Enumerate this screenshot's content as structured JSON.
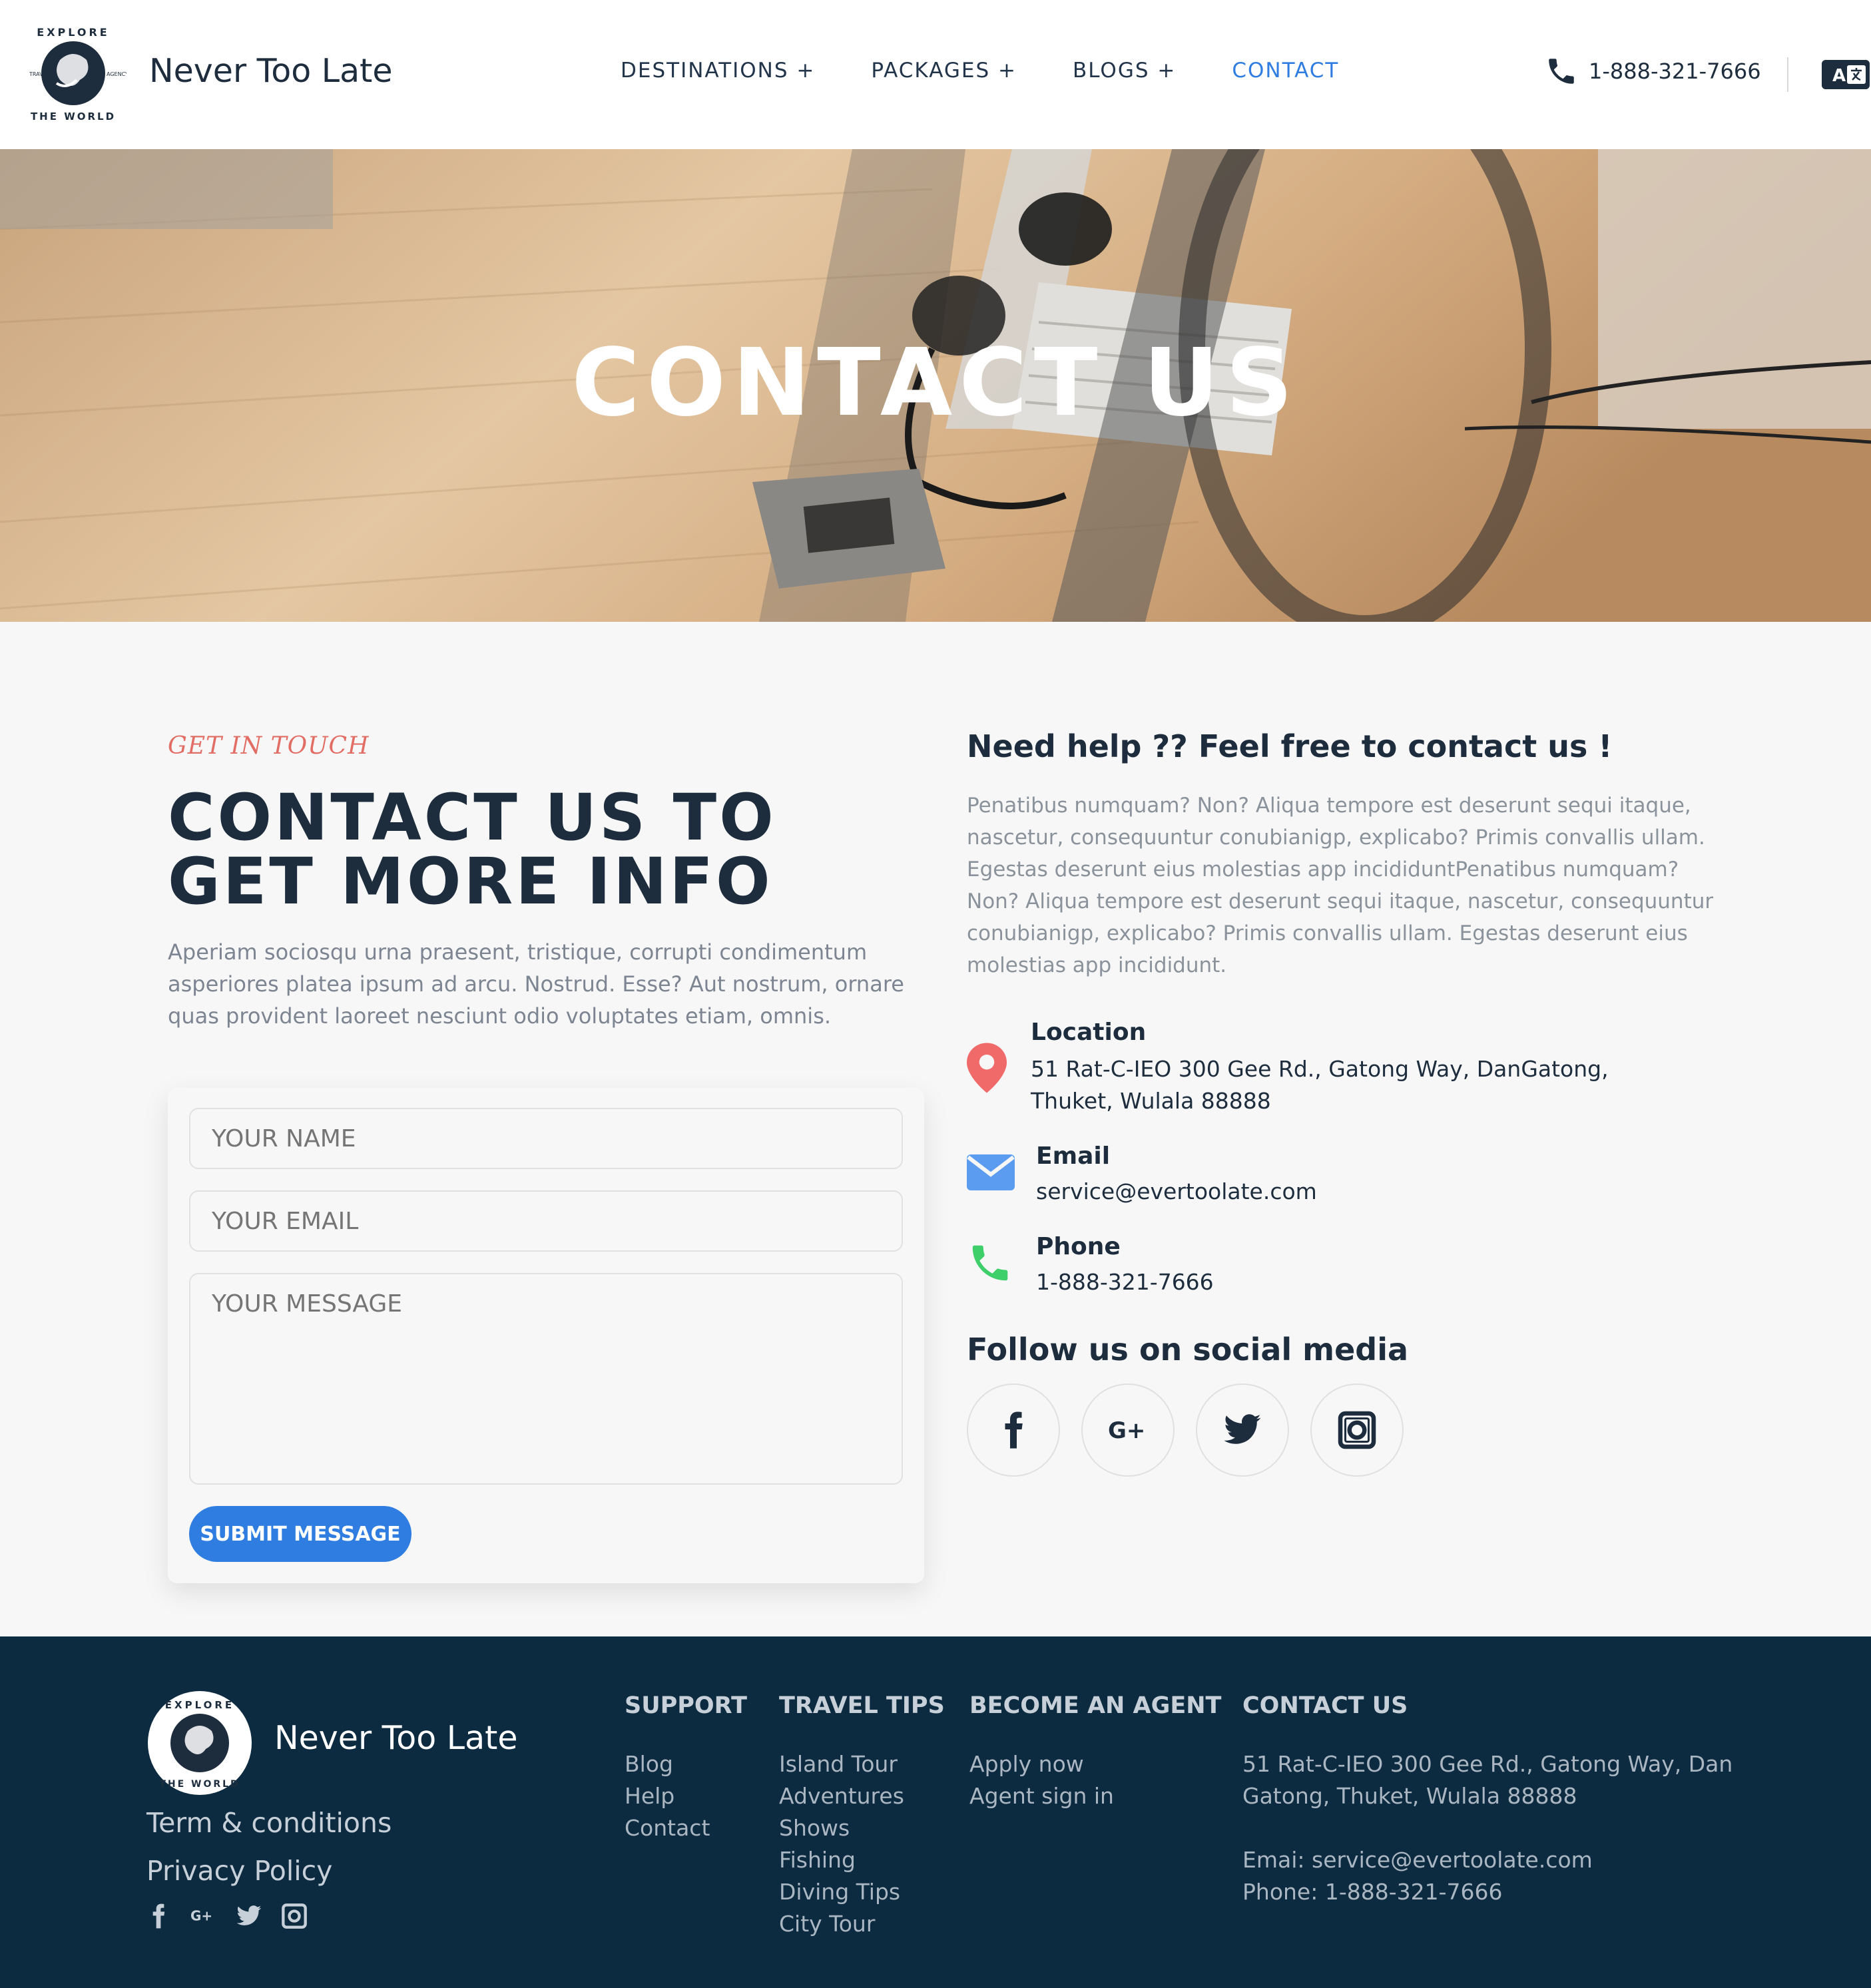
{
  "header": {
    "brand": "Never Too Late",
    "nav": [
      "DESTINATIONS +",
      "PACKAGES +",
      "BLOGS +",
      "CONTACT"
    ],
    "active_nav": "CONTACT",
    "phone": "1-888-321-7666",
    "logo_text": {
      "top": "EXPLORE",
      "bottom": "THE WORLD",
      "left": "TRAVEL",
      "right": "AGENCY"
    }
  },
  "hero": {
    "title": "CONTACT US"
  },
  "contact": {
    "kicker": "GET IN TOUCH",
    "heading": "CONTACT US TO GET MORE INFO",
    "intro": "Aperiam sociosqu urna praesent, tristique, corrupti condimentum asperiores platea ipsum ad arcu. Nostrud. Esse? Aut nostrum, ornare quas provident laoreet nesciunt odio voluptates etiam, omnis."
  },
  "form": {
    "name_placeholder": "YOUR NAME",
    "email_placeholder": "YOUR EMAIL",
    "message_placeholder": "YOUR MESSAGE",
    "submit_label": "SUBMIT MESSAGE"
  },
  "help": {
    "title": "Need help ?? Feel free to contact us !",
    "text": "Penatibus numquam? Non? Aliqua tempore est deserunt sequi itaque, nascetur, consequuntur conubianigp, explicabo? Primis convallis ullam. Egestas deserunt eius molestias app incididuntPenatibus numquam? Non? Aliqua tempore est deserunt sequi itaque, nascetur, consequuntur conubianigp, explicabo? Primis convallis ullam. Egestas deserunt eius molestias app incididunt."
  },
  "info": {
    "location_label": "Location",
    "location_value": "51 Rat-C-IEO 300 Gee Rd., Gatong Way, DanGatong, Thuket, Wulala 88888",
    "email_label": "Email",
    "email_value": "service@evertoolate.com",
    "phone_label": "Phone",
    "phone_value": "1-888-321-7666"
  },
  "social": {
    "title": "Follow us on social media",
    "icons": [
      "facebook-icon",
      "google-plus-icon",
      "twitter-icon",
      "instagram-icon"
    ]
  },
  "footer": {
    "brand": "Never Too Late",
    "links": [
      "Term & conditions",
      "Privacy Policy"
    ],
    "columns": [
      {
        "title": "SUPPORT",
        "items": [
          "Blog",
          "Help",
          "Contact"
        ]
      },
      {
        "title": "TRAVEL TIPS",
        "items": [
          "Island Tour",
          "Adventures",
          "Shows",
          "Fishing",
          "Diving Tips",
          "City Tour"
        ]
      },
      {
        "title": "BECOME AN AGENT",
        "items": [
          "Apply now",
          "Agent sign in"
        ]
      }
    ],
    "contact_title": "CONTACT US",
    "contact_address": "51 Rat-C-IEO 300 Gee Rd., Gatong Way, Dan Gatong, Thuket, Wulala 88888",
    "contact_email": "Emai: service@evertoolate.com",
    "contact_phone": "Phone: 1-888-321-7666"
  },
  "colors": {
    "accent": "#2f7de1",
    "kicker": "#e26d64",
    "location_pin": "#f06a6a",
    "email_icon": "#5b9cf0",
    "phone_icon": "#3ecf6a",
    "footer_bg": "#0d2b40",
    "dark_text": "#1e2d3d"
  }
}
